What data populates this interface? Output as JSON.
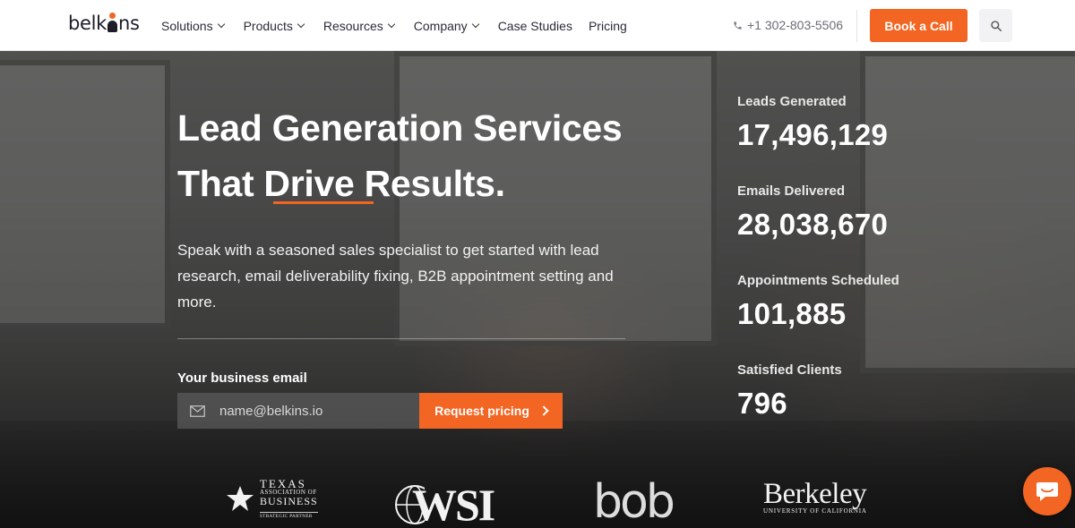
{
  "brand": {
    "logo_text_pre": "belk",
    "logo_text_post": "ns",
    "accent": "#f26522"
  },
  "nav": {
    "items": [
      {
        "label": "Solutions",
        "dropdown": true
      },
      {
        "label": "Products",
        "dropdown": true
      },
      {
        "label": "Resources",
        "dropdown": true
      },
      {
        "label": "Company",
        "dropdown": true
      },
      {
        "label": "Case Studies",
        "dropdown": false
      },
      {
        "label": "Pricing",
        "dropdown": false
      }
    ],
    "phone": "+1 302-803-5506",
    "cta_label": "Book a Call",
    "search_icon": "search-icon"
  },
  "hero": {
    "title_line1": "Lead Generation Services",
    "title_line2": "That Drive Results.",
    "description": "Speak with a seasoned sales specialist to get started with lead research, email deliverability fixing, B2B appointment setting and more.",
    "email_label": "Your business email",
    "email_placeholder": "name@belkins.io",
    "submit_label": "Request pricing"
  },
  "stats": [
    {
      "label": "Leads Generated",
      "value": "17,496,129"
    },
    {
      "label": "Emails Delivered",
      "value": "28,038,670"
    },
    {
      "label": "Appointments Scheduled",
      "value": "101,885"
    },
    {
      "label": "Satisfied Clients",
      "value": "796"
    }
  ],
  "partners": {
    "texas": {
      "line1": "TEXAS",
      "line2": "ASSOCIATION OF",
      "line3": "BUSINESS",
      "line4": "STRATEGIC PARTNER"
    },
    "wsi": "WSI",
    "bob": "bob",
    "berkeley": {
      "name": "Berkeley",
      "sub": "UNIVERSITY OF CALIFORNIA"
    }
  },
  "chat_icon": "chat-bubble-icon"
}
